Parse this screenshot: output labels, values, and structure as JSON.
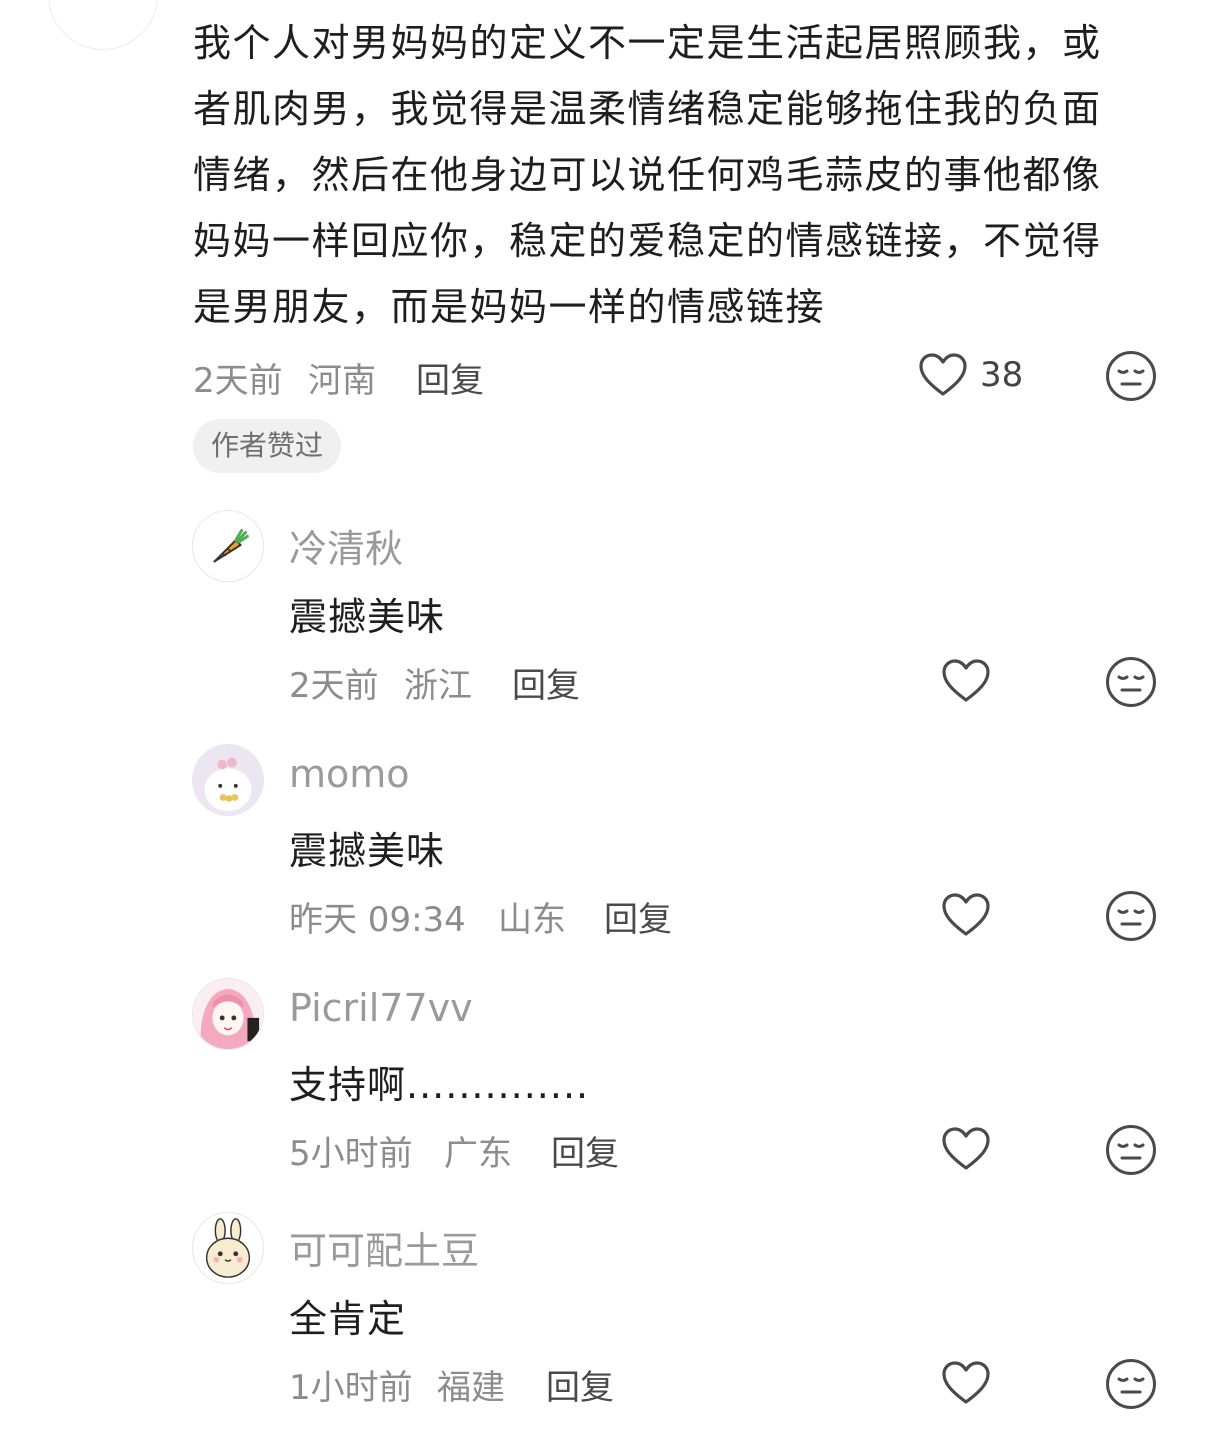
{
  "main_comment": {
    "text": "我个人对男妈妈的定义不一定是生活起居照顾我，或\n者肌肉男，我觉得是温柔情绪稳定能够拖住我的负面\n情绪，然后在他身边可以说任何鸡毛蒜皮的事他都像\n妈妈一样回应你，稳定的爱稳定的情感链接，不觉得\n是男朋友，而是妈妈一样的情感链接",
    "time": "2天前",
    "location": "河南",
    "reply_label": "回复",
    "like_count": "38",
    "badge": "作者赞过"
  },
  "replies": [
    {
      "username": "冷清秋",
      "text": "震撼美味",
      "time": "2天前",
      "location": "浙江",
      "reply_label": "回复",
      "avatar_icon": "carrot-avatar"
    },
    {
      "username": "momo",
      "text": "震撼美味",
      "time": "昨天 09:34",
      "location": "山东",
      "reply_label": "回复",
      "avatar_icon": "cute-blob-avatar"
    },
    {
      "username": "Picril77vv",
      "text": "支持啊..............",
      "time": "5小时前",
      "location": "广东",
      "reply_label": "回复",
      "avatar_icon": "anime-girl-avatar"
    },
    {
      "username": "可可配土豆",
      "text": "全肯定",
      "time": "1小时前",
      "location": "福建",
      "reply_label": "回复",
      "avatar_icon": "bunny-avatar"
    }
  ],
  "colors": {
    "text": "#1e1e1e",
    "meta": "#8c8c8c",
    "username": "#9a9a9a",
    "badge_bg": "#f0f0f0"
  }
}
